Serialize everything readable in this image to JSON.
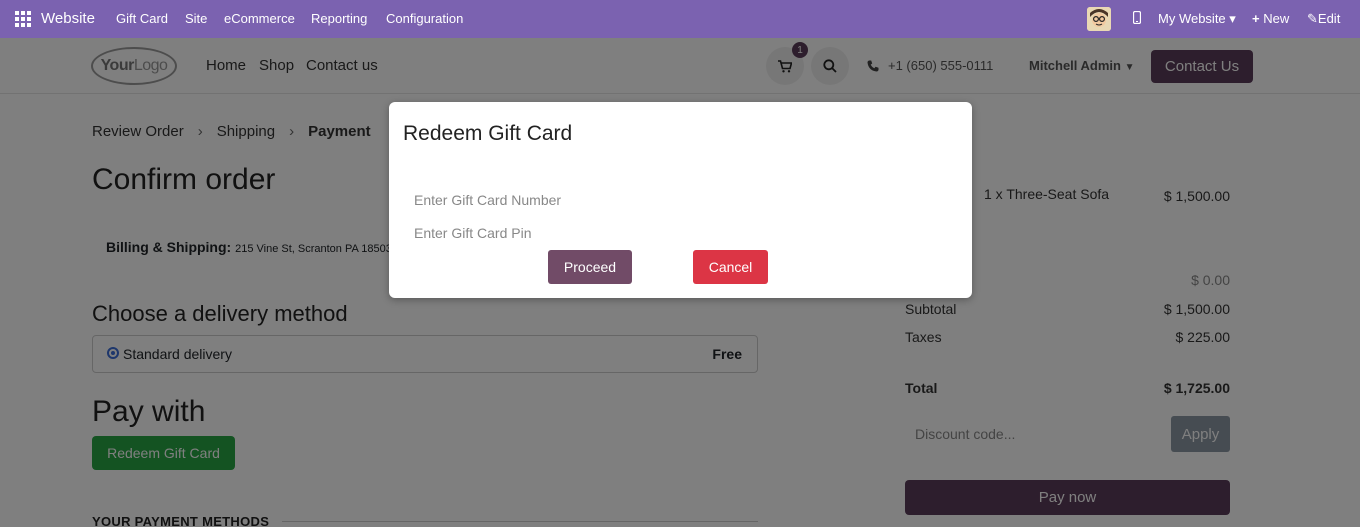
{
  "topbar": {
    "app_name": "Website",
    "menu": [
      "Gift Card",
      "Site",
      "eCommerce",
      "Reporting",
      "Configuration"
    ],
    "website_selector": "My Website",
    "new_label": "New",
    "edit_label": "Edit"
  },
  "header": {
    "logo_text_bold": "Your",
    "logo_text_light": "Logo",
    "nav": [
      "Home",
      "Shop",
      "Contact us"
    ],
    "cart_count": "1",
    "phone": "+1 (650) 555-0111",
    "user": "Mitchell Admin",
    "contact_button": "Contact Us"
  },
  "checkout": {
    "breadcrumbs": [
      "Review Order",
      "Shipping",
      "Payment"
    ],
    "title": "Confirm order",
    "billing_label": "Billing & Shipping:",
    "billing_address": "215 Vine St, Scranton PA 18503, U",
    "delivery_title": "Choose a delivery method",
    "delivery_option": "Standard delivery",
    "delivery_price": "Free",
    "pay_title": "Pay with",
    "redeem_button": "Redeem Gift Card",
    "methods_title": "YOUR PAYMENT METHODS"
  },
  "summary": {
    "item": "1 x Three-Seat Sofa",
    "item_price": "$ 1,500.00",
    "delivery_amount": "$ 0.00",
    "subtotal_label": "Subtotal",
    "subtotal": "$ 1,500.00",
    "taxes_label": "Taxes",
    "taxes": "$ 225.00",
    "total_label": "Total",
    "total": "$ 1,725.00",
    "discount_placeholder": "Discount code...",
    "apply_button": "Apply",
    "pay_button": "Pay now"
  },
  "modal": {
    "title": "Redeem Gift Card",
    "number_placeholder": "Enter Gift Card Number",
    "pin_placeholder": "Enter Gift Card Pin",
    "proceed": "Proceed",
    "cancel": "Cancel"
  },
  "colors": {
    "topbar": "#7b62b0",
    "brand": "#5b3d5a",
    "proceed": "#714b67",
    "cancel": "#dc3545",
    "redeem": "#28a745"
  }
}
